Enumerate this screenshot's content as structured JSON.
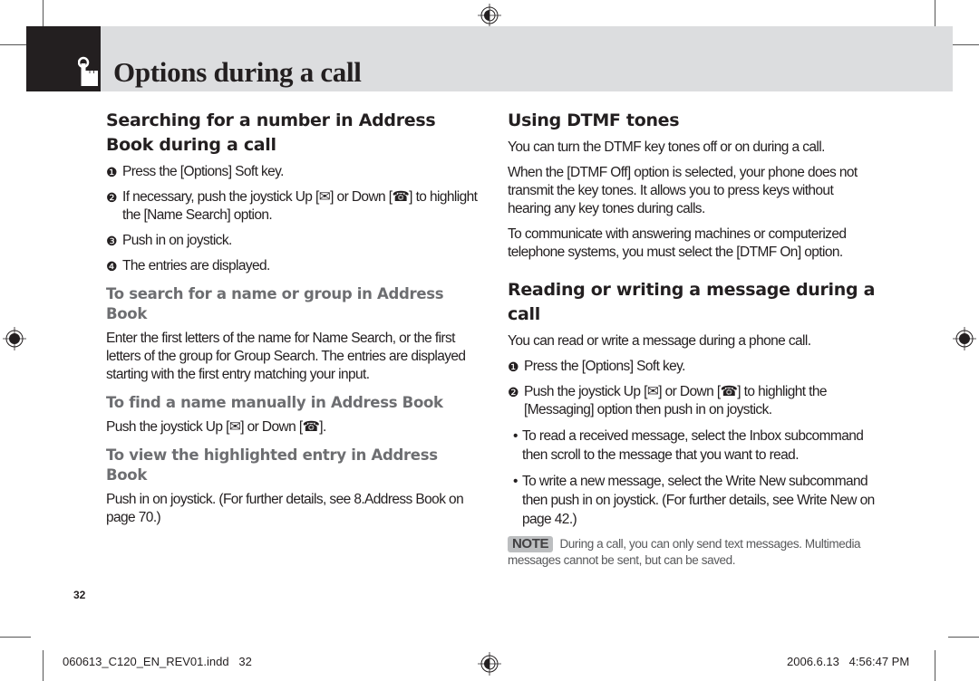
{
  "header": {
    "title": "Options during a call",
    "icon": "hand-pointer-icon"
  },
  "left_column": {
    "heading": "Searching for a number in Address Book during a call",
    "steps": [
      {
        "num": "❶",
        "text": "Press the [Options] Soft key."
      },
      {
        "num": "❷",
        "text": "If necessary, push the joystick Up [✉] or Down [☎] to highlight the [Name Search] option."
      },
      {
        "num": "❸",
        "text": "Push in on joystick."
      },
      {
        "num": "❹",
        "text": "The entries are displayed."
      }
    ],
    "sub1": {
      "heading": "To search for a name or group in Address Book",
      "text": "Enter the first letters of the name for Name Search, or the first letters of the group for Group Search. The entries are displayed starting with the first entry matching your input."
    },
    "sub2": {
      "heading": "To find a name manually in Address Book",
      "text": "Push the joystick Up [✉] or Down [☎]."
    },
    "sub3": {
      "heading": "To view the highlighted entry in Address Book",
      "text": "Push in on joystick. (For further details, see 8.Address Book on page 70.)"
    }
  },
  "right_column": {
    "dtmf": {
      "heading": "Using DTMF tones",
      "paragraphs": [
        "You can turn the DTMF key tones off or on during a call.",
        "When the [DTMF Off] option is selected, your phone does not transmit the key tones. It allows you to press keys without hearing any key tones during calls.",
        "To communicate with answering machines or computerized telephone systems, you must select the [DTMF On] option."
      ]
    },
    "message": {
      "heading": "Reading or writing a message during a call",
      "intro": "You can read or write a message during a phone call.",
      "steps": [
        {
          "num": "❶",
          "text": "Press the [Options] Soft key."
        },
        {
          "num": "❷",
          "text": "Push the joystick Up [✉] or Down [☎] to highlight the [Messaging] option then push in on joystick."
        }
      ],
      "bullets": [
        "To read a received message, select the Inbox subcommand then scroll to the message that you want to read.",
        "To write a new message, select the Write New subcommand then push in on joystick. (For further details, see Write New on page 42.)"
      ],
      "note_label": "NOTE",
      "note_text": "During a call, you can only send text messages. Multimedia messages cannot be sent, but can be saved."
    }
  },
  "page_number": "32",
  "footer": {
    "file": "060613_C120_EN_REV01.indd   32",
    "timestamp": "2006.6.13   4:56:47 PM"
  }
}
